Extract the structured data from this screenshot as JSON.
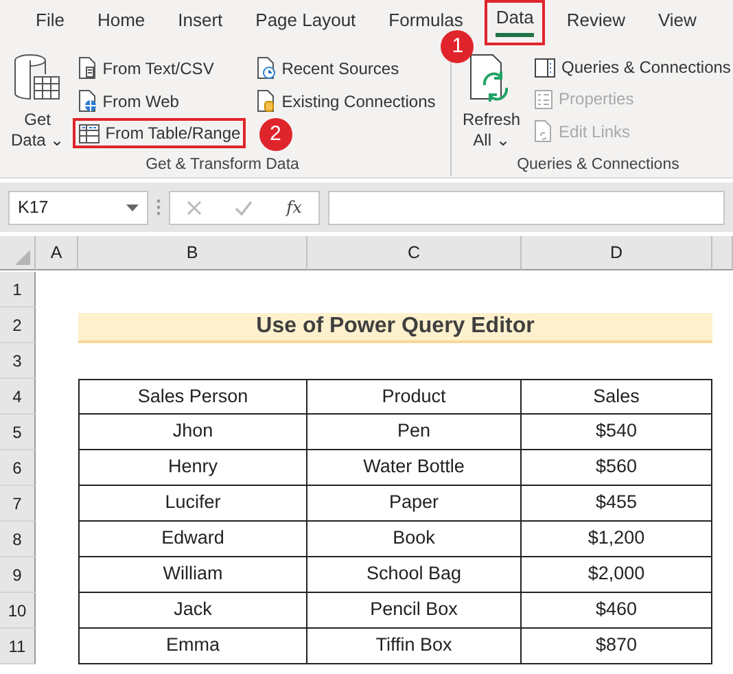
{
  "tabs": [
    {
      "label": "File",
      "selected": false
    },
    {
      "label": "Home",
      "selected": false
    },
    {
      "label": "Insert",
      "selected": false
    },
    {
      "label": "Page Layout",
      "selected": false
    },
    {
      "label": "Formulas",
      "selected": false
    },
    {
      "label": "Data",
      "selected": true,
      "callout": "1"
    },
    {
      "label": "Review",
      "selected": false
    },
    {
      "label": "View",
      "selected": false
    }
  ],
  "ribbon_groups": [
    {
      "name": "Get & Transform Data",
      "big_button": {
        "label_lines": [
          "Get",
          "Data"
        ],
        "kind": "database",
        "caret": "⌄"
      },
      "columns": [
        [
          {
            "label": "From Text/CSV",
            "kind": "text-file",
            "disabled": false
          },
          {
            "label": "From Web",
            "kind": "web-file",
            "disabled": false
          },
          {
            "label": "From Table/Range",
            "kind": "table",
            "disabled": false,
            "callout": "2"
          }
        ],
        [
          {
            "label": "Recent Sources",
            "kind": "clock-file",
            "disabled": false
          },
          {
            "label": "Existing Connections",
            "kind": "db-file",
            "disabled": false
          }
        ]
      ]
    },
    {
      "name": "Queries & Connections",
      "big_button": {
        "label_lines": [
          "Refresh",
          "All"
        ],
        "kind": "refresh",
        "caret": "⌄"
      },
      "columns": [
        [
          {
            "label": "Queries & Connections",
            "kind": "pane",
            "disabled": false
          },
          {
            "label": "Properties",
            "kind": "list",
            "disabled": true
          },
          {
            "label": "Edit Links",
            "kind": "link-file",
            "disabled": true
          }
        ]
      ]
    }
  ],
  "formula_bar": {
    "name_box": "K17",
    "fx": "fx"
  },
  "columns": [
    "A",
    "B",
    "C",
    "D"
  ],
  "row_numbers": [
    "1",
    "2",
    "3",
    "4",
    "5",
    "6",
    "7",
    "8",
    "9",
    "10",
    "11"
  ],
  "sheet": {
    "title": "Use of Power Query Editor",
    "header": [
      "Sales Person",
      "Product",
      "Sales"
    ],
    "rows": [
      [
        "Jhon",
        "Pen",
        "$540"
      ],
      [
        "Henry",
        "Water Bottle",
        "$560"
      ],
      [
        "Lucifer",
        "Paper",
        "$455"
      ],
      [
        "Edward",
        "Book",
        "$1,200"
      ],
      [
        "William",
        "School Bag",
        "$2,000"
      ],
      [
        "Jack",
        "Pencil Box",
        "$460"
      ],
      [
        "Emma",
        "Tiffin Box",
        "$870"
      ]
    ]
  }
}
